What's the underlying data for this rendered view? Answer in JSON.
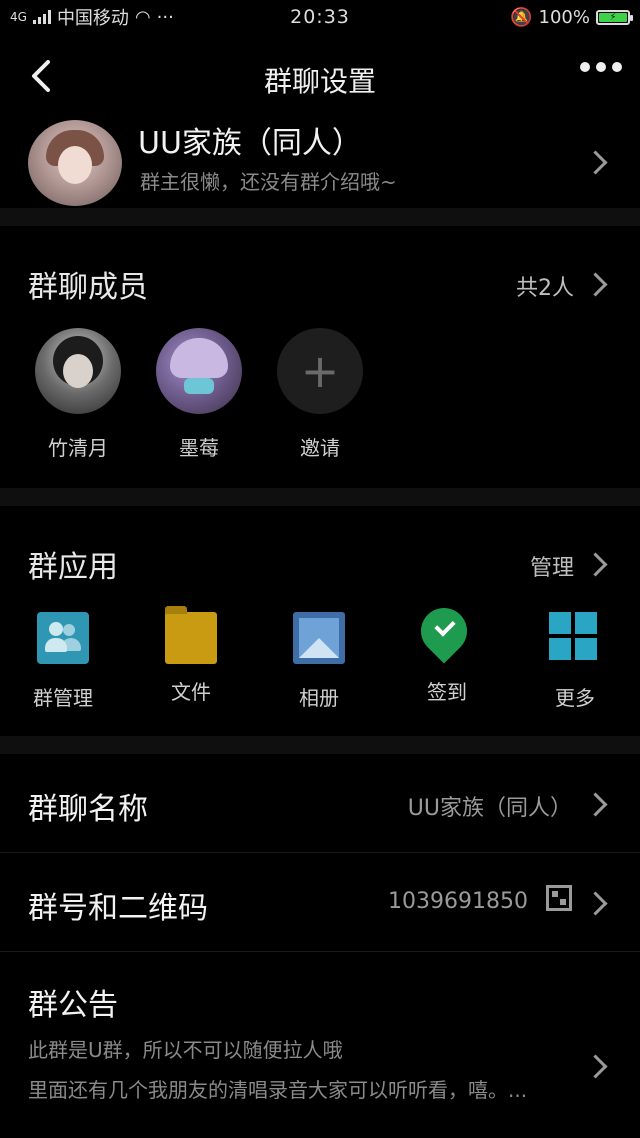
{
  "status_bar": {
    "network": "4G",
    "carrier": "中国移动",
    "more": "···",
    "time": "20:33",
    "battery": "100%"
  },
  "nav": {
    "title": "群聊设置"
  },
  "group": {
    "name": "UU家族（同人）",
    "description": "群主很懒，还没有群介绍哦~"
  },
  "members": {
    "title": "群聊成员",
    "count": "共2人",
    "items": [
      {
        "name": "竹清月"
      },
      {
        "name": "墨莓"
      },
      {
        "name": "邀请"
      }
    ]
  },
  "apps": {
    "title": "群应用",
    "manage": "管理",
    "items": [
      {
        "label": "群管理",
        "icon": "group-manage-icon"
      },
      {
        "label": "文件",
        "icon": "folder-icon"
      },
      {
        "label": "相册",
        "icon": "album-icon"
      },
      {
        "label": "签到",
        "icon": "checkin-icon"
      },
      {
        "label": "更多",
        "icon": "more-grid-icon"
      }
    ]
  },
  "settings": {
    "group_name_label": "群聊名称",
    "group_name_value": "UU家族（同人）",
    "group_id_label": "群号和二维码",
    "group_id_value": "1039691850"
  },
  "announcement": {
    "title": "群公告",
    "text": "此群是U群，所以不可以随便拉人哦\n里面还有几个我朋友的清唱录音大家可以听听看，嘻。..."
  },
  "colors": {
    "background": "#000000",
    "battery_fill": "#3ed14a",
    "checkin_green": "#1e9b4f",
    "folder_yellow": "#c89b12",
    "accent_blue": "#2aa6c4"
  }
}
